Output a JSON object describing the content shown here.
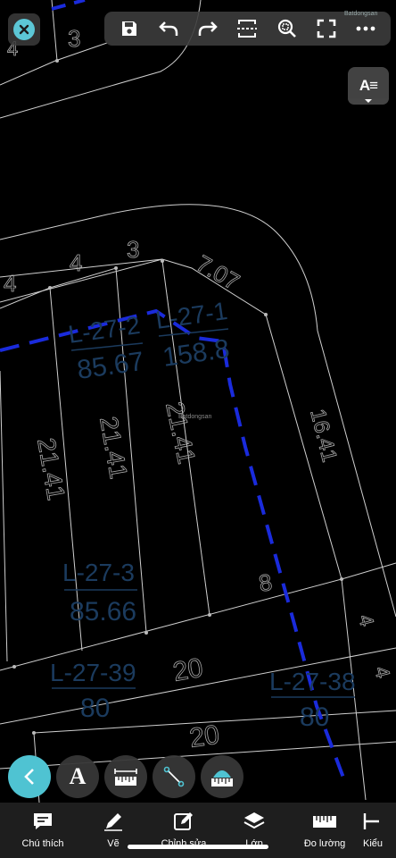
{
  "watermark": "Batdongsan",
  "ae_button_label": "A≡",
  "cad": {
    "lot_labels": [
      {
        "id": "L-27-2",
        "area": "85.67"
      },
      {
        "id": "L-27-1",
        "area": "158.8"
      },
      {
        "id": "L-27-3",
        "area": "85.66"
      },
      {
        "id": "L-27-39",
        "area": "80"
      },
      {
        "id": "L-27-38",
        "area": "80"
      }
    ],
    "dimensions": [
      "3",
      "4",
      "4",
      "4",
      "3",
      "7.07",
      "21.41",
      "21.41",
      "21.41",
      "16.41",
      "8",
      "4",
      "20",
      "20",
      "4"
    ]
  },
  "tools": {
    "back": "back-chevron",
    "text": "A"
  },
  "bottom_nav": [
    {
      "label": "Chú thích",
      "icon": "comment-icon"
    },
    {
      "label": "Vẽ",
      "icon": "pencil-icon"
    },
    {
      "label": "Chỉnh sửa",
      "icon": "edit-icon"
    },
    {
      "label": "Lớp",
      "icon": "layers-icon"
    },
    {
      "label": "Đo lường",
      "icon": "ruler-icon"
    },
    {
      "label": "Kiểu",
      "icon": "style-icon"
    }
  ],
  "colors": {
    "accent": "#4fc3d2",
    "cad_text": "#1a3a5a",
    "dashed_line": "#1a2bdc",
    "grid_line": "#d0d0d0"
  }
}
